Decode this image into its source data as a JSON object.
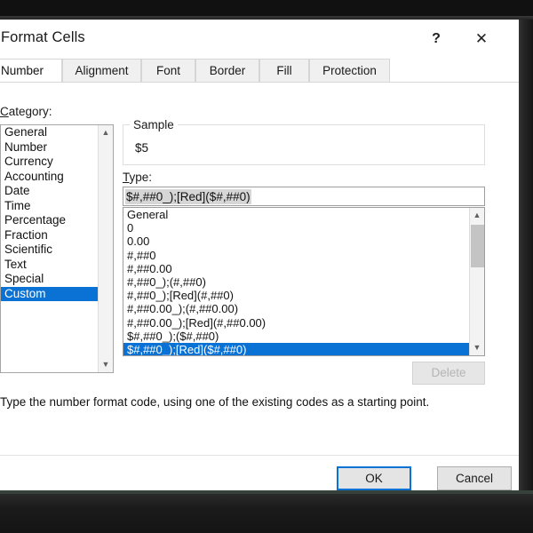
{
  "window": {
    "title": "Format Cells",
    "help_icon": "question-mark-icon",
    "close_icon": "close-icon"
  },
  "tabs": [
    {
      "label": "Number",
      "active": true
    },
    {
      "label": "Alignment",
      "active": false
    },
    {
      "label": "Font",
      "active": false
    },
    {
      "label": "Border",
      "active": false
    },
    {
      "label": "Fill",
      "active": false
    },
    {
      "label": "Protection",
      "active": false
    }
  ],
  "category": {
    "label": "Category:",
    "items": [
      "General",
      "Number",
      "Currency",
      "Accounting",
      "Date",
      "Time",
      "Percentage",
      "Fraction",
      "Scientific",
      "Text",
      "Special",
      "Custom"
    ],
    "selected": "Custom",
    "scroll_up_icon": "chevron-up-icon",
    "scroll_down_icon": "chevron-down-icon"
  },
  "sample": {
    "legend": "Sample",
    "value": "$5"
  },
  "type": {
    "label": "Type:",
    "value": "$#,##0_);[Red]($#,##0)",
    "selection_highlight": "#d6d6d6"
  },
  "format_list": {
    "items": [
      "General",
      "0",
      "0.00",
      "#,##0",
      "#,##0.00",
      "#,##0_);(#,##0)",
      "#,##0_);[Red](#,##0)",
      "#,##0.00_);(#,##0.00)",
      "#,##0.00_);[Red](#,##0.00)",
      "$#,##0_);($#,##0)",
      "$#,##0_);[Red]($#,##0)"
    ],
    "selected": "$#,##0_);[Red]($#,##0)",
    "scroll_up_icon": "chevron-up-icon",
    "scroll_down_icon": "chevron-down-icon"
  },
  "delete_button": {
    "label": "Delete",
    "enabled": false
  },
  "hint": "Type the number format code, using one of the existing codes as a starting point.",
  "footer": {
    "ok_label": "OK",
    "cancel_label": "Cancel"
  },
  "colors": {
    "selection_blue": "#0a72d4",
    "focus_blue": "#0a72d4",
    "dialog_bg": "#ffffff",
    "bezel": "#111111"
  }
}
